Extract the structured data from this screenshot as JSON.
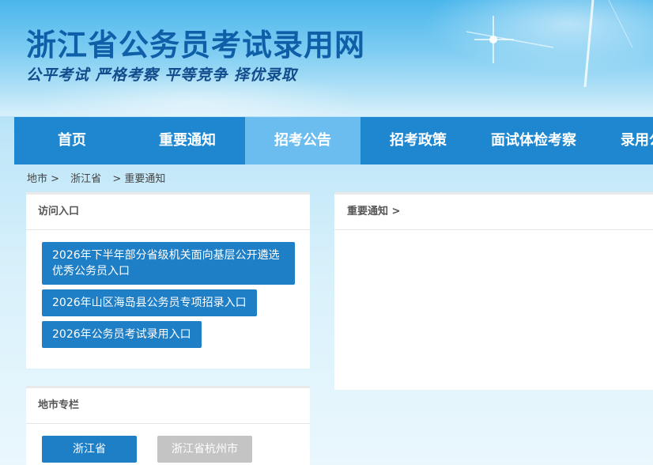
{
  "header": {
    "title": "浙江省公务员考试录用网",
    "slogan": "公平考试 严格考察 平等竞争 择优录取"
  },
  "nav": {
    "items": [
      {
        "label": "首页"
      },
      {
        "label": "重要通知"
      },
      {
        "label": "招考公告"
      },
      {
        "label": "招考政策"
      },
      {
        "label": "面试体检考察"
      },
      {
        "label": "录用公示"
      }
    ],
    "active_index": 2
  },
  "breadcrumb": {
    "items": [
      "地市 >",
      "浙江省",
      "> 重要通知"
    ]
  },
  "access": {
    "title": "访问入口",
    "links": [
      {
        "label": "2026年下半年部分省级机关面向基层公开遴选优秀公务员入口"
      },
      {
        "label": "2026年山区海岛县公务员专项招录入口"
      },
      {
        "label": "2026年公务员考试录用入口"
      }
    ]
  },
  "city": {
    "title": "地市专栏",
    "buttons": [
      {
        "label": "浙江省"
      },
      {
        "label": "浙江省杭州市"
      }
    ]
  },
  "notice": {
    "title": "重要通知 >"
  },
  "colors": {
    "nav_bg": "#1e87d0",
    "nav_active": "#6bbdf0",
    "button": "#1e7fc6",
    "button_muted": "#c4c4c4",
    "title": "#0f5fa8"
  }
}
